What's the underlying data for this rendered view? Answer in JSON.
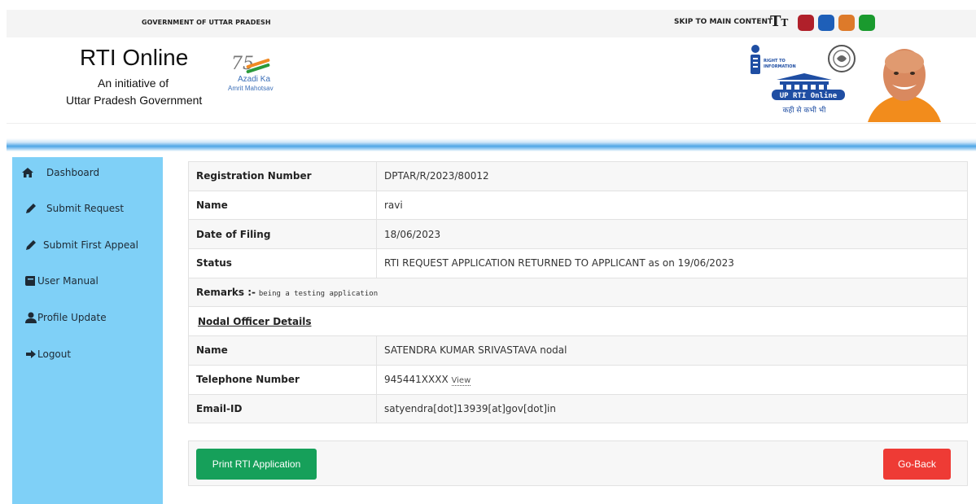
{
  "topbar": {
    "gov_label": "GOVERNMENT OF UTTAR PRADESH",
    "skip_link": "SKIP TO MAIN CONTENT",
    "text_size_icon": "T",
    "text_size_icon_small": "T",
    "theme_colors": [
      "#b0202a",
      "#1e5fb8",
      "#dd7a2a",
      "#1a9a2e"
    ]
  },
  "header": {
    "title": "RTI Online",
    "subtitle1": "An initiative of",
    "subtitle2": "Uttar Pradesh Government",
    "azadi_logo": {
      "numeral": "75",
      "line1": "Azadi Ka",
      "line2": "Amrit Mahotsav"
    },
    "rti_logo": {
      "line1": "RIGHT TO",
      "line2": "INFORMATION",
      "badge": "UP RTI Online",
      "tagline": "कही से कभी भी"
    }
  },
  "sidebar": {
    "items": [
      {
        "label": "Dashboard",
        "icon": "home-icon"
      },
      {
        "label": "Submit Request",
        "icon": "pencil-icon"
      },
      {
        "label": "Submit First Appeal",
        "icon": "pencil-icon"
      },
      {
        "label": "User Manual",
        "icon": "book-icon"
      },
      {
        "label": "Profile Update",
        "icon": "user-icon"
      },
      {
        "label": "Logout",
        "icon": "sign-out-icon"
      }
    ]
  },
  "details": {
    "registration_number": {
      "label": "Registration Number",
      "value": "DPTAR/R/2023/80012"
    },
    "name": {
      "label": "Name",
      "value": "ravi"
    },
    "date_of_filing": {
      "label": "Date of Filing",
      "value": "18/06/2023"
    },
    "status": {
      "label": "Status",
      "value": "RTI REQUEST APPLICATION RETURNED TO APPLICANT as on 19/06/2023"
    },
    "remarks": {
      "label": "Remarks :-",
      "value": "being a testing application"
    },
    "nodal_heading": "Nodal Officer Details",
    "nodal_name": {
      "label": "Name",
      "value": "SATENDRA KUMAR SRIVASTAVA nodal"
    },
    "telephone": {
      "label": "Telephone Number",
      "value": "945441XXXX",
      "view_link": "View"
    },
    "email": {
      "label": "Email-ID",
      "value": "satyendra[dot]13939[at]gov[dot]in"
    }
  },
  "actions": {
    "print_label": "Print RTI Application",
    "back_label": "Go-Back"
  }
}
